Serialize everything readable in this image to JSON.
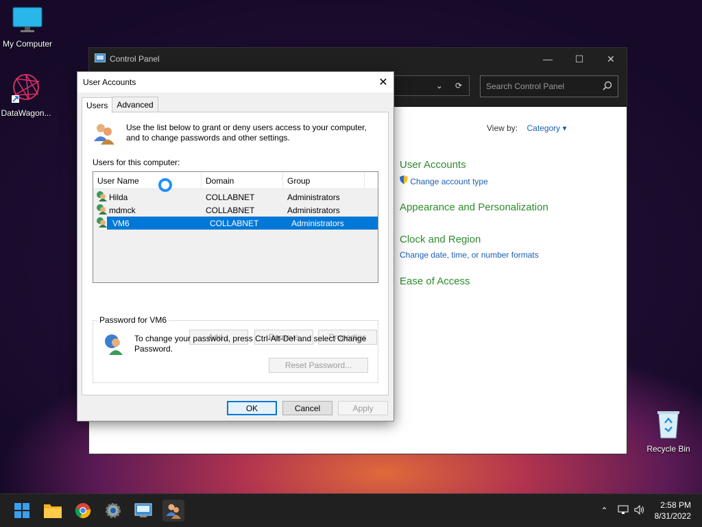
{
  "desktop": {
    "icons": [
      {
        "label": "My Computer"
      },
      {
        "label": "DataWagon..."
      },
      {
        "label": "Recycle Bin"
      }
    ]
  },
  "control_panel": {
    "title": "Control Panel",
    "search_placeholder": "Search Control Panel",
    "view_by_label": "View by:",
    "view_by_value": "Category",
    "categories": [
      {
        "heading": "User Accounts",
        "link": "Change account type"
      },
      {
        "heading": "Appearance and Personalization"
      },
      {
        "heading": "Clock and Region",
        "link": "Change date, time, or number formats"
      },
      {
        "heading": "Ease of Access"
      }
    ]
  },
  "dialog": {
    "title": "User Accounts",
    "tabs": [
      "Users",
      "Advanced"
    ],
    "intro": "Use the list below to grant or deny users access to your computer, and to change passwords and other settings.",
    "users_label": "Users for this computer:",
    "columns": [
      "User Name",
      "Domain",
      "Group"
    ],
    "rows": [
      {
        "name": "Hilda",
        "domain": "COLLABNET",
        "group": "Administrators"
      },
      {
        "name": "mdmck",
        "domain": "COLLABNET",
        "group": "Administrators"
      },
      {
        "name": "VM6",
        "domain": "COLLABNET",
        "group": "Administrators"
      }
    ],
    "buttons": {
      "add": "Add...",
      "remove": "Remove",
      "properties": "Properties"
    },
    "password_group_title": "Password for VM6",
    "password_text": "To change your password, press Ctrl-Alt-Del and select Change Password.",
    "reset_button": "Reset Password...",
    "ok": "OK",
    "cancel": "Cancel",
    "apply": "Apply"
  },
  "taskbar": {
    "time": "2:58 PM",
    "date": "8/31/2022"
  },
  "colors": {
    "accent": "#0078d7",
    "cp_heading": "#2e8b2e",
    "cp_link": "#1a5fb4"
  }
}
